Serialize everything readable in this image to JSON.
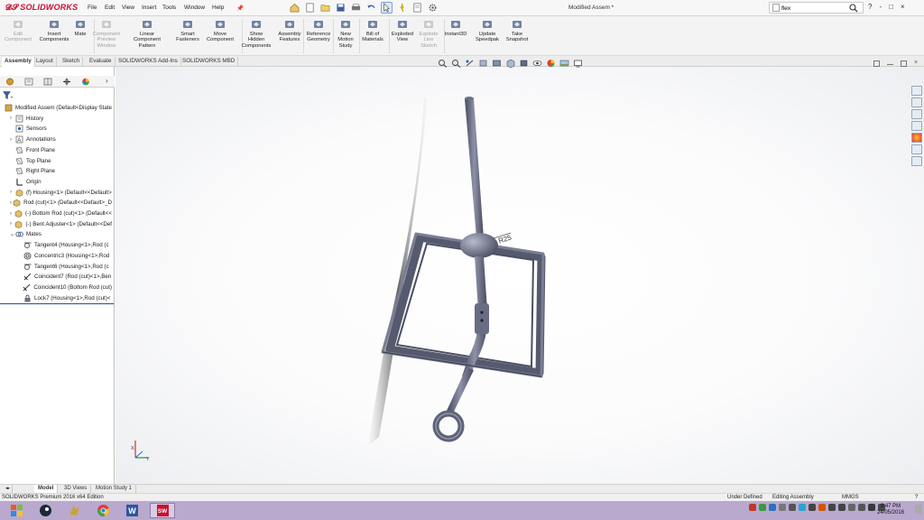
{
  "app": {
    "logo_text": "SOLIDWORKS",
    "document_title": "Modified Assem *",
    "menus": [
      "File",
      "Edit",
      "View",
      "Insert",
      "Tools",
      "Window",
      "Help"
    ],
    "search": {
      "value": "flex",
      "placeholder": ""
    },
    "window_controls": [
      "?",
      "-",
      "□",
      "×"
    ]
  },
  "commands": [
    {
      "label": "Edit\nComponent",
      "icon": "edit-component-icon",
      "enabled": false
    },
    {
      "label": "Insert\nComponents",
      "icon": "insert-components-icon",
      "enabled": true
    },
    {
      "label": "Mate",
      "icon": "mate-icon",
      "enabled": true
    },
    {
      "label": "Component\nPreview\nWindow",
      "icon": "preview-window-icon",
      "enabled": false
    },
    {
      "label": "Linear Component\nPattern",
      "icon": "linear-pattern-icon",
      "enabled": true
    },
    {
      "label": "Smart\nFasteners",
      "icon": "smart-fasteners-icon",
      "enabled": true
    },
    {
      "label": "Move\nComponent",
      "icon": "move-component-icon",
      "enabled": true
    },
    {
      "label": "Show\nHidden\nComponents",
      "icon": "show-hidden-icon",
      "enabled": true
    },
    {
      "label": "Assembly\nFeatures",
      "icon": "assembly-features-icon",
      "enabled": true
    },
    {
      "label": "Reference\nGeometry",
      "icon": "reference-geometry-icon",
      "enabled": true
    },
    {
      "label": "New\nMotion\nStudy",
      "icon": "motion-study-icon",
      "enabled": true
    },
    {
      "label": "Bill of\nMaterials",
      "icon": "bom-icon",
      "enabled": true
    },
    {
      "label": "Exploded\nView",
      "icon": "exploded-view-icon",
      "enabled": true
    },
    {
      "label": "Explode\nLine\nSketch",
      "icon": "explode-line-icon",
      "enabled": false
    },
    {
      "label": "Instant3D",
      "icon": "instant3d-icon",
      "enabled": true
    },
    {
      "label": "Update\nSpeedpak",
      "icon": "speedpak-icon",
      "enabled": true
    },
    {
      "label": "Take\nSnapshot",
      "icon": "snapshot-icon",
      "enabled": true
    }
  ],
  "tabs": [
    "Assembly",
    "Layout",
    "Sketch",
    "Evaluate",
    "SOLIDWORKS Add-Ins",
    "SOLIDWORKS MBD"
  ],
  "active_tab": "Assembly",
  "tree": [
    {
      "label": "Modified Assem  (Default<Display State",
      "icon": "assembly-icon",
      "toggle": "",
      "indent": 0
    },
    {
      "label": "History",
      "icon": "history-icon",
      "toggle": "›",
      "indent": 1
    },
    {
      "label": "Sensors",
      "icon": "sensors-icon",
      "toggle": "",
      "indent": 1
    },
    {
      "label": "Annotations",
      "icon": "annotations-icon",
      "toggle": "›",
      "indent": 1
    },
    {
      "label": "Front Plane",
      "icon": "plane-icon",
      "toggle": "",
      "indent": 1
    },
    {
      "label": "Top Plane",
      "icon": "plane-icon",
      "toggle": "",
      "indent": 1
    },
    {
      "label": "Right Plane",
      "icon": "plane-icon",
      "toggle": "",
      "indent": 1
    },
    {
      "label": "Origin",
      "icon": "origin-icon",
      "toggle": "",
      "indent": 1
    },
    {
      "label": "(f) Housing<1> (Default<<Default>",
      "icon": "part-icon",
      "toggle": "›",
      "indent": 1
    },
    {
      "label": "Rod (cut)<1> (Default<<Default>_D",
      "icon": "part-icon",
      "toggle": "›",
      "indent": 1
    },
    {
      "label": "(-) Bottom Rod (cut)<1> (Default<<",
      "icon": "part-icon",
      "toggle": "›",
      "indent": 1
    },
    {
      "label": "(-) Bent Adjuster<1> (Default<<Def",
      "icon": "part-icon",
      "toggle": "›",
      "indent": 1
    },
    {
      "label": "Mates",
      "icon": "mates-icon",
      "toggle": "⌄",
      "indent": 1
    },
    {
      "label": "Tangent4 (Housing<1>,Rod (c",
      "icon": "tangent-mate-icon",
      "toggle": "",
      "indent": 2
    },
    {
      "label": "Concentric3 (Housing<1>,Rod",
      "icon": "concentric-mate-icon",
      "toggle": "",
      "indent": 2
    },
    {
      "label": "Tangent6 (Housing<1>,Rod (c",
      "icon": "tangent-mate-icon",
      "toggle": "",
      "indent": 2
    },
    {
      "label": "Coincident7 (Rod (cut)<1>,Ben",
      "icon": "coincident-mate-icon",
      "toggle": "",
      "indent": 2
    },
    {
      "label": "Coincident10 (Bottom Rod (cut)",
      "icon": "coincident-mate-icon",
      "toggle": "",
      "indent": 2
    },
    {
      "label": "Lock7 (Housing<1>,Rod (cut)<",
      "icon": "lock-mate-icon",
      "toggle": "",
      "indent": 2
    }
  ],
  "model_annotation": "R25",
  "triad": {
    "x": "X",
    "y": "Y"
  },
  "bottom_tabs": [
    "Model",
    "3D Views",
    "Motion Study 1"
  ],
  "active_bottom_tab": "Model",
  "status": {
    "edition": "SOLIDWORKS Premium 2016 x64 Edition",
    "definition": "Under Defined",
    "mode": "Editing Assembly",
    "units": "MMGS"
  },
  "clock": {
    "time": "9:47 PM",
    "date": "24/05/2016"
  },
  "colors": {
    "brand": "#c8102e",
    "part": "#6b6f86",
    "taskbar": "#b9a9cf"
  }
}
